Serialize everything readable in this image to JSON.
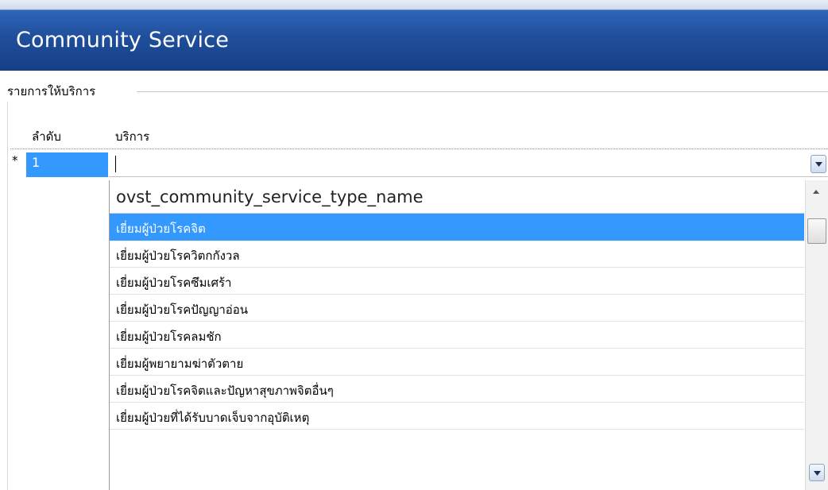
{
  "header": {
    "title": "Community Service"
  },
  "group": {
    "title": "รายการให้บริการ"
  },
  "grid": {
    "columns": [
      "ลำดับ",
      "บริการ"
    ],
    "new_row_marker": "*",
    "current_row": {
      "number": "1",
      "service_value": ""
    }
  },
  "dropdown": {
    "column_header": "ovst_community_service_type_name",
    "items": [
      "เยี่ยมผู้ป่วยโรคจิต",
      "เยี่ยมผู้ป่วยโรควิตกกังวล",
      "เยี่ยมผู้ป่วยโรคซึมเศร้า",
      "เยี่ยมผู้ป่วยโรคปัญญาอ่อน",
      "เยี่ยมผู้ป่วยโรคลมชัก",
      "เยี่ยมผู้พยายามฆ่าตัวตาย",
      "เยี่ยมผู้ป่วยโรคจิตและปัญหาสุขภาพจิตอื่นๆ",
      "เยี่ยมผู้ป่วยที่ได้รับบาดเจ็บจากอุบัติเหตุ"
    ],
    "selected_index": 0
  },
  "colors": {
    "header": "#1f4e9b",
    "selection": "#3399ff"
  },
  "icons": {
    "combo_button": "chevron-down-icon",
    "scroll_up": "chevron-up-icon",
    "scroll_down": "chevron-down-icon"
  }
}
